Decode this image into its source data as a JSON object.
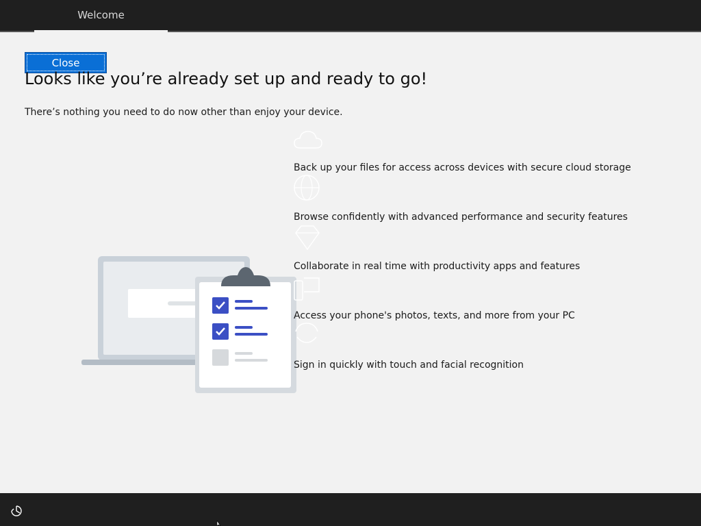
{
  "header": {
    "tab_label": "Welcome"
  },
  "main": {
    "close_label": "Close",
    "title": "Looks like you’re already set up and ready to go!",
    "subtitle": "There’s nothing you need to do now other than enjoy your device.",
    "features": [
      {
        "icon": "cloud-icon",
        "text": "Back up your files for access across devices with secure cloud storage"
      },
      {
        "icon": "globe-icon",
        "text": "Browse confidently with advanced performance and security features"
      },
      {
        "icon": "diamond-icon",
        "text": "Collaborate in real time with productivity apps and features"
      },
      {
        "icon": "phone-pc-icon",
        "text": "Access your phone's photos, texts, and more from your PC"
      },
      {
        "icon": "face-recognition-icon",
        "text": "Sign in quickly with touch and facial recognition"
      }
    ]
  },
  "colors": {
    "accent": "#0a6fd6",
    "bar_background": "#1f1f1f",
    "page_background": "#f2f2f2"
  }
}
